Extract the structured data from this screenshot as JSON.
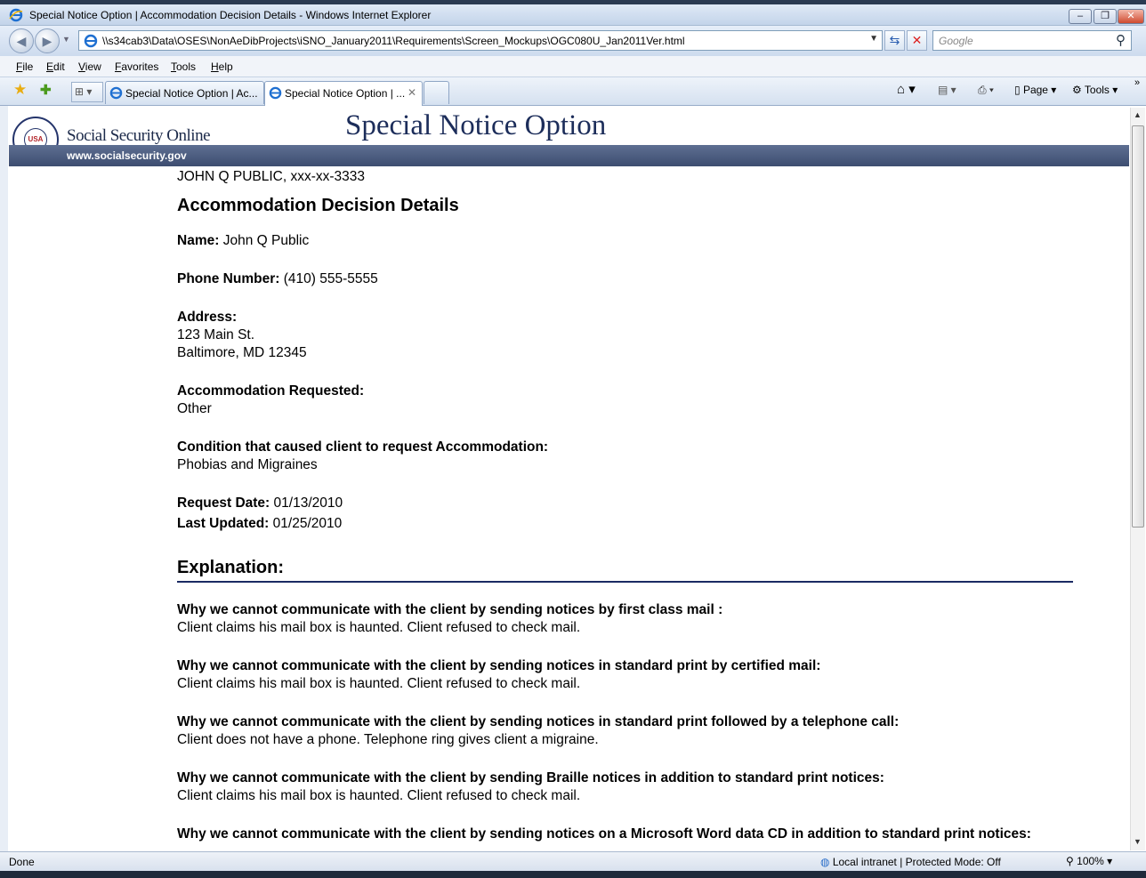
{
  "window": {
    "title": "Special Notice Option | Accommodation Decision Details - Windows Internet Explorer"
  },
  "address_bar": {
    "url": "\\\\s34cab3\\Data\\OSES\\NonAeDibProjects\\iSNO_January2011\\Requirements\\Screen_Mockups\\OGC080U_Jan2011Ver.html",
    "search_placeholder": "Google"
  },
  "menu": [
    "File",
    "Edit",
    "View",
    "Favorites",
    "Tools",
    "Help"
  ],
  "tabs": [
    {
      "label": "Special Notice Option | Ac...",
      "active": false
    },
    {
      "label": "Special Notice Option | ...",
      "active": true
    }
  ],
  "toolbar": {
    "page_label": "Page",
    "tools_label": "Tools"
  },
  "site_header": {
    "brand": "Social Security Online",
    "title": "Special Notice Option",
    "site_url": "www.socialsecurity.gov",
    "seal_text": "USA"
  },
  "record": {
    "client_line": "JOHN Q PUBLIC, xxx-xx-3333",
    "heading": "Accommodation Decision Details",
    "name_label": "Name:",
    "name_value": "John Q Public",
    "phone_label": "Phone Number:",
    "phone_value": "(410) 555-5555",
    "address_label": "Address:",
    "address_line1": "123 Main St.",
    "address_line2": "Baltimore, MD 12345",
    "accommodation_label": "Accommodation Requested:",
    "accommodation_value": "Other",
    "condition_label": "Condition that caused client to request Accommodation:",
    "condition_value": "Phobias and Migraines",
    "request_date_label": "Request Date:",
    "request_date_value": "01/13/2010",
    "last_updated_label": "Last Updated:",
    "last_updated_value": "01/25/2010"
  },
  "explanation": {
    "heading": "Explanation:",
    "items": [
      {
        "question": "Why we cannot communicate with the client by sending notices by first class mail :",
        "answer": "Client claims his mail box is haunted. Client refused to check mail."
      },
      {
        "question": "Why we cannot communicate with the client by sending notices in standard print by certified mail:",
        "answer": "Client claims his mail box is haunted. Client refused to check mail."
      },
      {
        "question": "Why we cannot communicate with the client by sending notices in standard print followed by a telephone call:",
        "answer": "Client does not have a phone. Telephone ring gives client a migraine."
      },
      {
        "question": "Why we cannot communicate with the client by sending Braille notices in addition to standard print notices:",
        "answer": "Client claims his mail box is haunted. Client refused to check mail."
      },
      {
        "question": "Why we cannot communicate with the client by sending notices on a Microsoft Word data CD in addition to standard print notices:",
        "answer": ""
      }
    ]
  },
  "status_bar": {
    "status": "Done",
    "zone": "Local intranet | Protected Mode: Off",
    "zoom": "100%"
  }
}
